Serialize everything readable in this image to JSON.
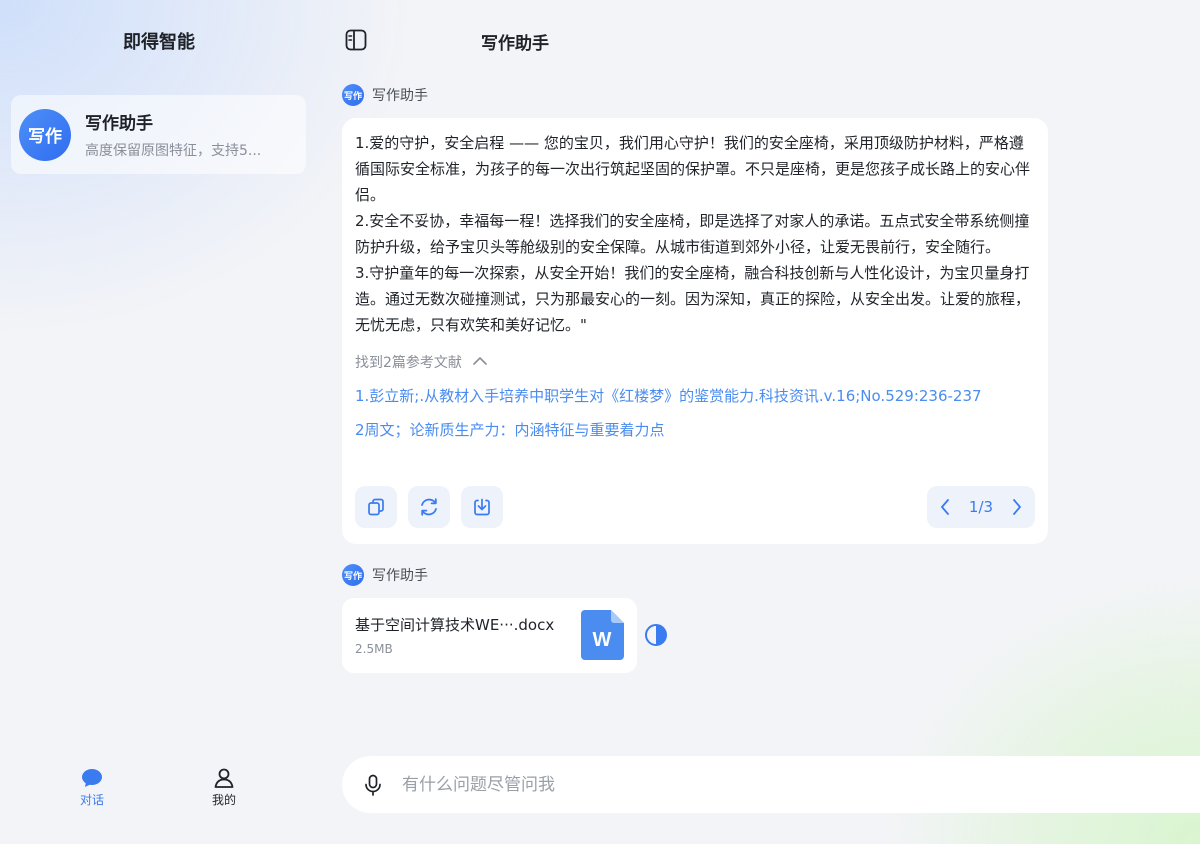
{
  "sidebar": {
    "app_title": "即得智能",
    "assistant": {
      "avatar_text": "写作",
      "name": "写作助手",
      "description": "高度保留原图特征，支持5..."
    },
    "nav": [
      {
        "label": "对话",
        "icon": "chat-bubble-icon",
        "active": true
      },
      {
        "label": "我的",
        "icon": "person-icon",
        "active": false
      }
    ]
  },
  "header": {
    "title": "写作助手",
    "toggle_icon": "sidebar-toggle-icon"
  },
  "messages": [
    {
      "sender_avatar": "写作",
      "sender": "写作助手",
      "paragraphs": [
        "1.爱的守护，安全启程 —— 您的宝贝，我们用心守护！我们的安全座椅，采用顶级防护材料，严格遵循国际安全标准，为孩子的每一次出行筑起坚固的保护罩。不只是座椅，更是您孩子成长路上的安心伴侣。",
        "2.安全不妥协，幸福每一程！选择我们的安全座椅，即是选择了对家人的承诺。五点式安全带系统侧撞防护升级，给予宝贝头等舱级别的安全保障。从城市街道到郊外小径，让爱无畏前行，安全随行。",
        "3.守护童年的每一次探索，从安全开始！我们的安全座椅，融合科技创新与人性化设计，为宝贝量身打造。通过无数次碰撞测试，只为那最安心的一刻。因为深知，真正的探险，从安全出发。让爱的旅程，无忧无虑，只有欢笑和美好记忆。\""
      ],
      "refs_header": "找到2篇参考文献",
      "refs": [
        "1.彭立新;.从教材入手培养中职学生对《红楼梦》的鉴赏能力.科技资讯.v.16;No.529:236-237",
        "2周文；论新质生产力：内涵特征与重要着力点"
      ],
      "actions": [
        "copy-icon",
        "regenerate-icon",
        "download-icon"
      ],
      "pager": "1/3"
    },
    {
      "sender_avatar": "写作",
      "sender": "写作助手",
      "file": {
        "name": "基于空间计算技术WE···.docx",
        "size": "2.5MB",
        "icon_letter": "W"
      }
    }
  ],
  "input": {
    "placeholder": "有什么问题尽管问我"
  },
  "colors": {
    "accent": "#3a7bf0",
    "link": "#4a8cf0",
    "card": "#ffffff"
  }
}
